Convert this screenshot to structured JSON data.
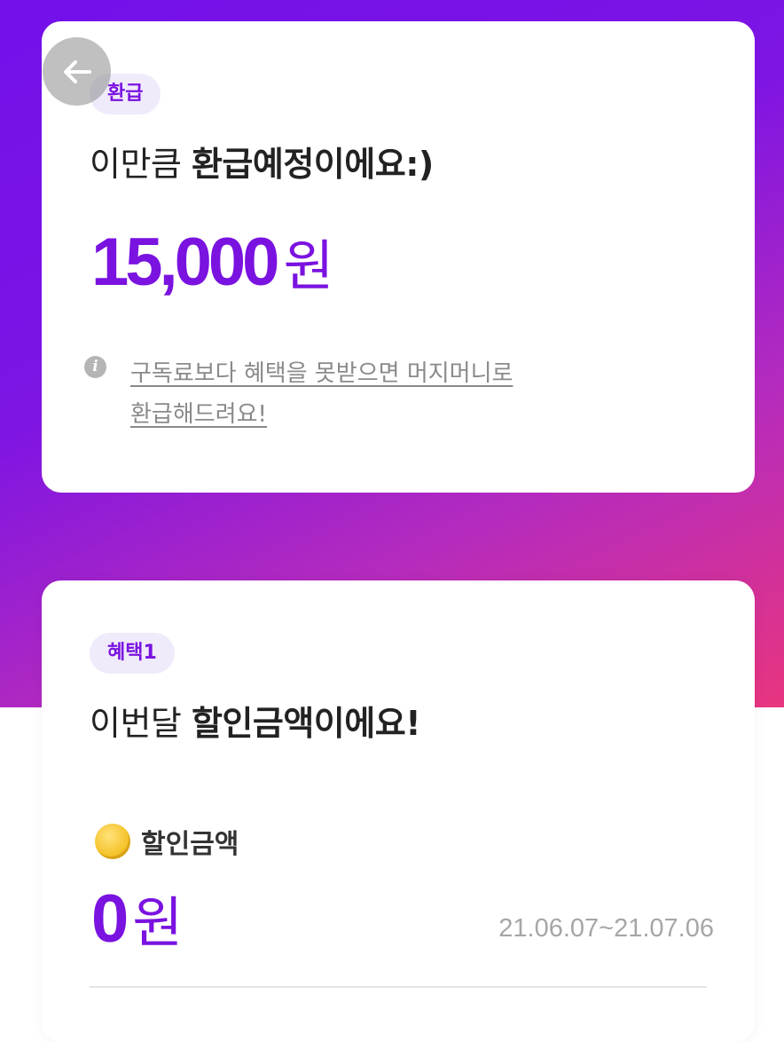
{
  "colors": {
    "accent": "#7a12e0",
    "gradient_start": "#7310ea",
    "gradient_end": "#e8357f",
    "pill_bg": "#f0ebfb"
  },
  "header": {
    "back_icon": "arrow-left-icon"
  },
  "refund_card": {
    "badge": "환급",
    "headline_prefix": "이만큼 ",
    "headline_strong": "환급예정이에요:)",
    "amount": "15,000",
    "unit": "원",
    "info_icon": "info-icon",
    "info_line1": "구독료보다 혜택을 못받으면 머지머니로",
    "info_line2": "환급해드려요!"
  },
  "benefit_card": {
    "badge": "혜택1",
    "headline_prefix": "이번달 ",
    "headline_strong": "할인금액이에요!",
    "coin_icon": "coin-icon",
    "label": "할인금액",
    "amount": "0",
    "unit": "원",
    "date_range": "21.06.07~21.07.06"
  }
}
